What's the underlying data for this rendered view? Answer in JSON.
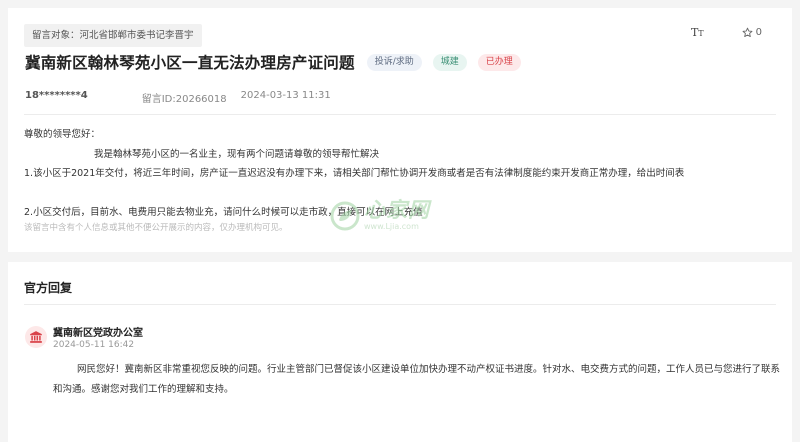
{
  "message": {
    "target_tag": "留言对象：河北省邯郸市委书记李晋宇",
    "font_tool_label": "TT",
    "favorite_count": "0",
    "title": "冀南新区翰林琴苑小区一直无法办理房产证问题",
    "badges": {
      "type": "投诉/求助",
      "dept": "城建",
      "status": "已办理"
    },
    "user_id": "18********4",
    "message_id": "留言ID:20266018",
    "datetime": "2024-03-13 11:31",
    "content": {
      "greeting": "尊敬的领导您好：",
      "intro": "我是翰林琴苑小区的一名业主，现有两个问题请尊敬的领导帮忙解决",
      "point1": "1.该小区于2021年交付，将近三年时间，房产证一直迟迟没有办理下来，请相关部门帮忙协调开发商或者是否有法律制度能约束开发商正常办理，给出时间表",
      "point2": "2.小区交付后，目前水、电费用只能去物业充，请问什么时候可以走市政，直接可以在网上充值"
    },
    "privacy_note": "该留言中含有个人信息或其他不便公开展示的内容，仅办理机构可见。",
    "watermark": {
      "main": "心家网",
      "sub": "www.Ljia.com"
    }
  },
  "reply": {
    "heading": "官方回复",
    "org_name": "冀南新区党政办公室",
    "date": "2024-05-11 16:42",
    "body": "网民您好！冀南新区非常重视您反映的问题。行业主管部门已督促该小区建设单位加快办理不动产权证书进度。针对水、电交费方式的问题，工作人员已与您进行了联系和沟通。感谢您对我们工作的理解和支持。"
  },
  "colors": {
    "status": "#d9434a",
    "dept": "#3a8f74",
    "type": "#5e6b80",
    "org_icon": "#d9434a"
  }
}
